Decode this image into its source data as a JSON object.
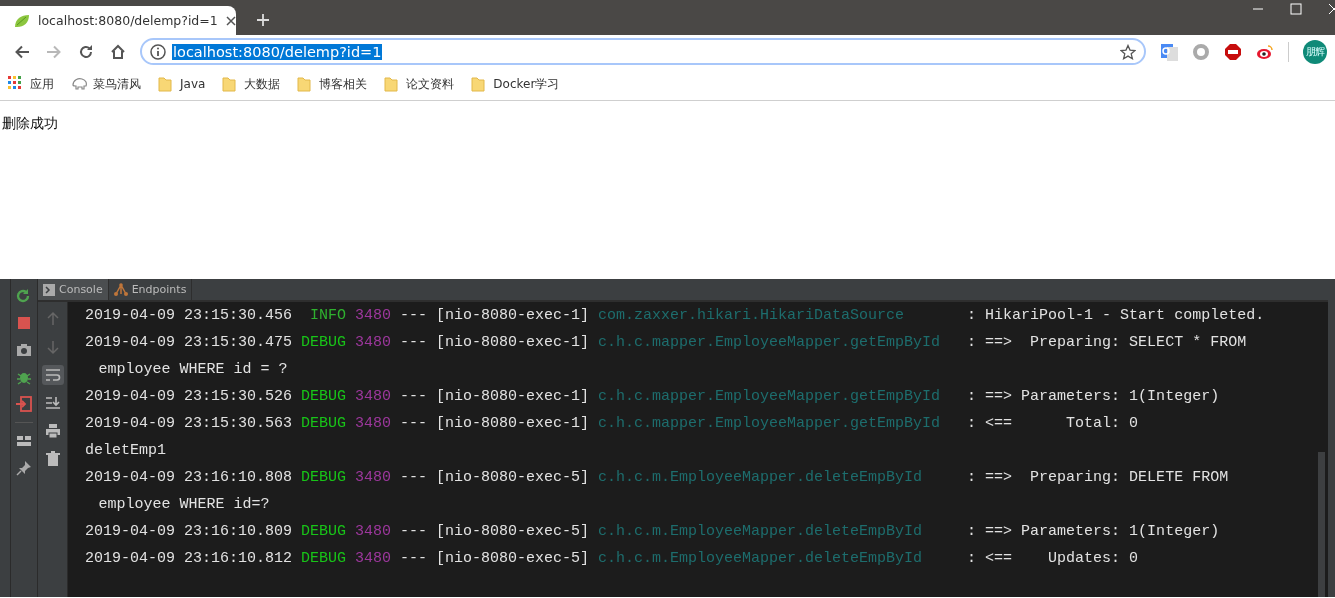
{
  "browser": {
    "tab": {
      "title": "localhost:8080/delemp?id=1",
      "selected": true
    },
    "nav": [
      {
        "kind": "back",
        "disabled": false
      },
      {
        "kind": "forward",
        "disabled": true
      },
      {
        "kind": "reload",
        "disabled": false
      },
      {
        "kind": "home",
        "disabled": false
      }
    ],
    "address": {
      "value": "localhost:8080/delemp?id=1",
      "selected": true
    },
    "extensions": [
      {
        "kind": "translate"
      },
      {
        "kind": "ring"
      },
      {
        "kind": "abp"
      },
      {
        "kind": "weibo"
      }
    ],
    "profile": {
      "initials": "朋辉"
    },
    "bookmarks": [
      {
        "label": "应用",
        "kind": "apps"
      },
      {
        "label": "菜鸟清风",
        "kind": "site"
      },
      {
        "label": "Java",
        "kind": "folder"
      },
      {
        "label": "大数据",
        "kind": "folder"
      },
      {
        "label": "博客相关",
        "kind": "folder"
      },
      {
        "label": "论文资料",
        "kind": "folder"
      },
      {
        "label": "Docker学习",
        "kind": "folder"
      }
    ]
  },
  "page": {
    "message": "删除成功"
  },
  "ide": {
    "tabs": [
      {
        "label": "Console",
        "kind": "console",
        "selected": true
      },
      {
        "label": "Endpoints",
        "kind": "endpoints",
        "selected": false
      }
    ],
    "log": [
      {
        "kind": "entry",
        "time": "2019-04-09 23:15:30.456",
        "level": "INFO",
        "pid": "3480",
        "sep": "---",
        "thread": "[nio-8080-exec-1]",
        "logger": "com.zaxxer.hikari.HikariDataSource",
        "message": ": HikariPool-1 - Start completed."
      },
      {
        "kind": "entry",
        "time": "2019-04-09 23:15:30.475",
        "level": "DEBUG",
        "pid": "3480",
        "sep": "---",
        "thread": "[nio-8080-exec-1]",
        "logger": "c.h.c.mapper.EmployeeMapper.getEmpById",
        "message": ": ==>  Preparing: SELECT * FROM"
      },
      {
        "kind": "wrap",
        "text": "employee WHERE id = ?"
      },
      {
        "kind": "entry",
        "time": "2019-04-09 23:15:30.526",
        "level": "DEBUG",
        "pid": "3480",
        "sep": "---",
        "thread": "[nio-8080-exec-1]",
        "logger": "c.h.c.mapper.EmployeeMapper.getEmpById",
        "message": ": ==> Parameters: 1(Integer)"
      },
      {
        "kind": "entry",
        "time": "2019-04-09 23:15:30.563",
        "level": "DEBUG",
        "pid": "3480",
        "sep": "---",
        "thread": "[nio-8080-exec-1]",
        "logger": "c.h.c.mapper.EmployeeMapper.getEmpById",
        "message": ": <==      Total: 0"
      },
      {
        "kind": "plain",
        "text": "deletEmp1"
      },
      {
        "kind": "entry",
        "time": "2019-04-09 23:16:10.808",
        "level": "DEBUG",
        "pid": "3480",
        "sep": "---",
        "thread": "[nio-8080-exec-5]",
        "logger": "c.h.c.m.EmployeeMapper.deleteEmpById",
        "message": ": ==>  Preparing: DELETE FROM"
      },
      {
        "kind": "wrap",
        "text": "employee WHERE id=?"
      },
      {
        "kind": "entry",
        "time": "2019-04-09 23:16:10.809",
        "level": "DEBUG",
        "pid": "3480",
        "sep": "---",
        "thread": "[nio-8080-exec-5]",
        "logger": "c.h.c.m.EmployeeMapper.deleteEmpById",
        "message": ": ==> Parameters: 1(Integer)"
      },
      {
        "kind": "entry",
        "time": "2019-04-09 23:16:10.812",
        "level": "DEBUG",
        "pid": "3480",
        "sep": "---",
        "thread": "[nio-8080-exec-5]",
        "logger": "c.h.c.m.EmployeeMapper.deleteEmpById",
        "message": ": <==    Updates: 0"
      }
    ]
  }
}
